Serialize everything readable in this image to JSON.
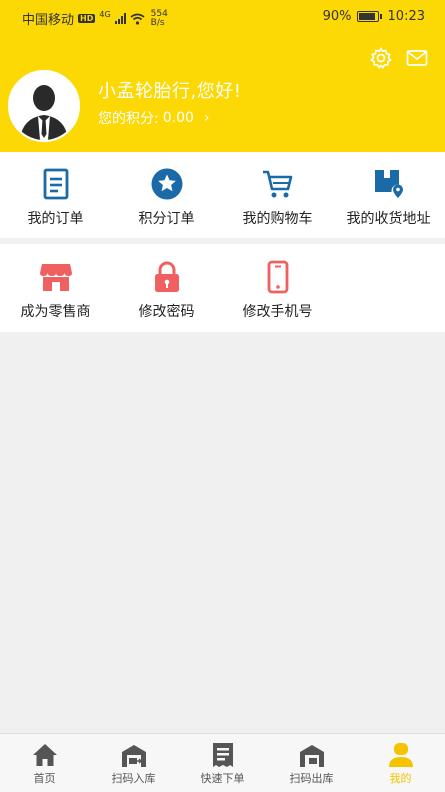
{
  "status_bar": {
    "carrier": "中国移动",
    "hd": "HD",
    "net_type": "4G",
    "speed_value": "554",
    "speed_unit": "B/s",
    "battery": "90%",
    "battery_level": 0.9,
    "time": "10:23"
  },
  "profile": {
    "greeting": "小孟轮胎行,您好!",
    "points_label": "您的积分:",
    "points_value": "0.00"
  },
  "menu_row1": [
    {
      "label": "我的订单",
      "icon": "order-list-icon"
    },
    {
      "label": "积分订单",
      "icon": "star-badge-icon"
    },
    {
      "label": "我的购物车",
      "icon": "cart-icon"
    },
    {
      "label": "我的收货地址",
      "icon": "address-box-icon"
    }
  ],
  "menu_row2": [
    {
      "label": "成为零售商",
      "icon": "store-icon"
    },
    {
      "label": "修改密码",
      "icon": "lock-icon"
    },
    {
      "label": "修改手机号",
      "icon": "phone-icon"
    }
  ],
  "bottom_nav": [
    {
      "label": "首页",
      "icon": "home-icon",
      "active": false
    },
    {
      "label": "扫码入库",
      "icon": "warehouse-in-icon",
      "active": false
    },
    {
      "label": "快速下单",
      "icon": "quick-order-icon",
      "active": false
    },
    {
      "label": "扫码出库",
      "icon": "warehouse-out-icon",
      "active": false
    },
    {
      "label": "我的",
      "icon": "user-icon",
      "active": true
    }
  ],
  "colors": {
    "header_bg": "#fcd804",
    "primary_blue": "#1a6aa8",
    "accent_red": "#f06060",
    "active_tab": "#f5c400"
  }
}
